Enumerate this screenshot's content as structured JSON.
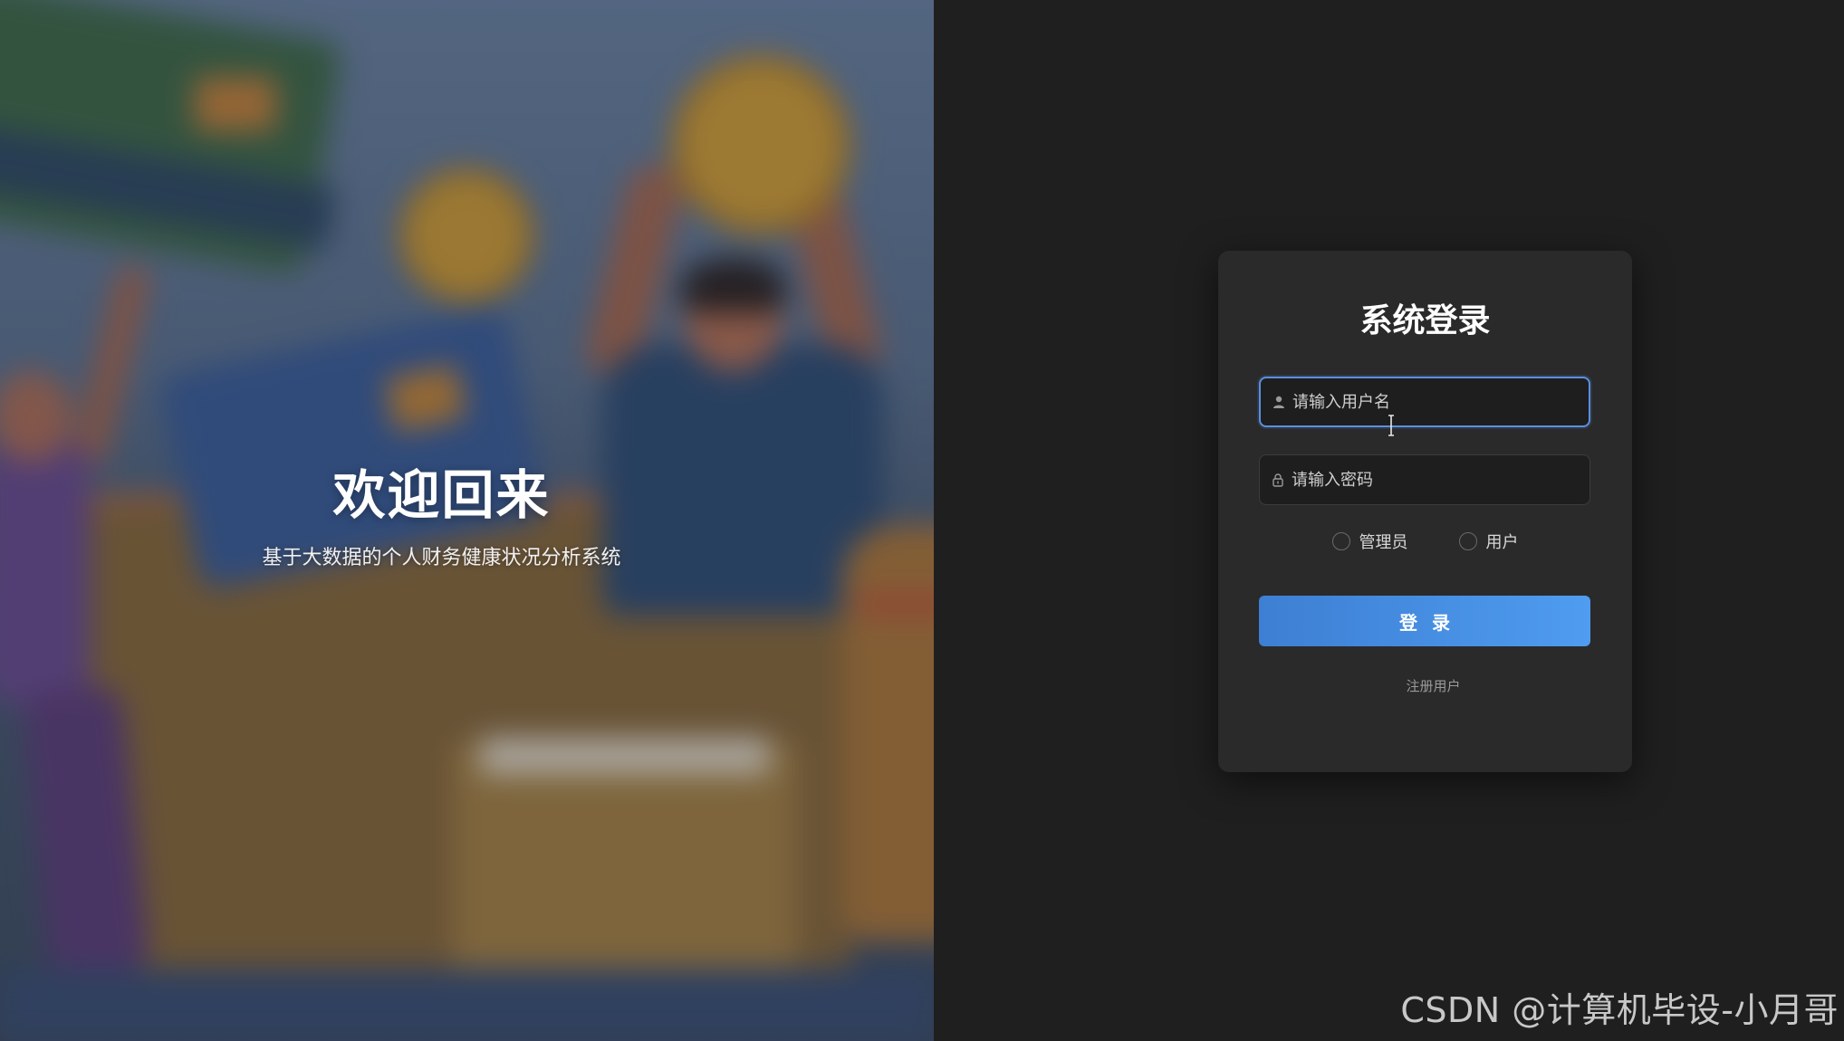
{
  "hero": {
    "title": "欢迎回来",
    "subtitle": "基于大数据的个人财务健康状况分析系统"
  },
  "login": {
    "title": "系统登录",
    "username": {
      "placeholder": "请输入用户名",
      "value": "",
      "icon": "user-icon"
    },
    "password": {
      "placeholder": "请输入密码",
      "value": "",
      "icon": "lock-icon"
    },
    "roles": [
      {
        "label": "管理员",
        "checked": false
      },
      {
        "label": "用户",
        "checked": false
      }
    ],
    "submit_label": "登录",
    "register_label": "注册用户"
  },
  "watermark": "CSDN @计算机毕设-小月哥",
  "colors": {
    "accent": "#4f9cf0",
    "focus_border": "#5b8fe0",
    "card_bg": "#2a2a2a",
    "page_bg": "#1f1f1f"
  }
}
